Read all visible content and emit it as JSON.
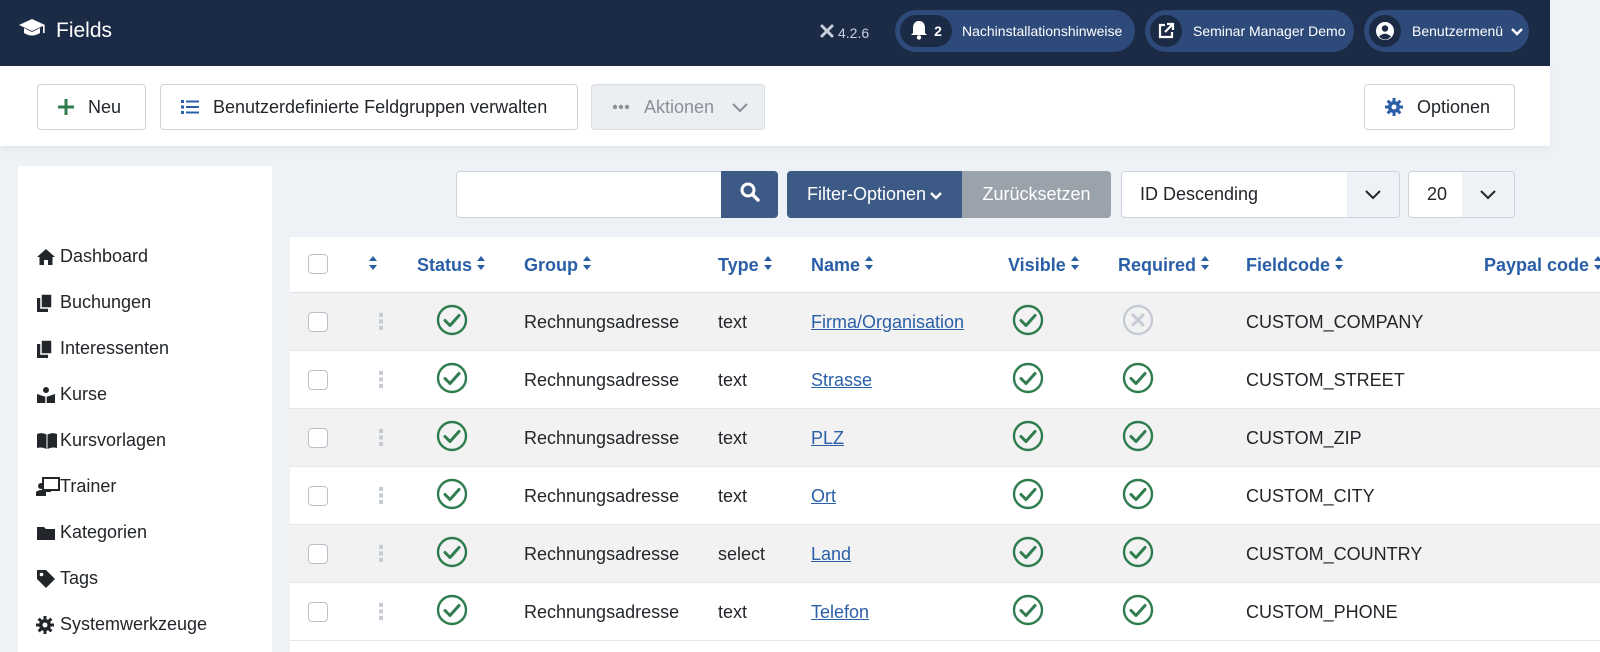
{
  "header": {
    "title": "Fields",
    "version": "4.2.6",
    "notifications_count": "2",
    "post_install_label": "Nachinstallationshinweise",
    "site_label": "Seminar Manager Demo",
    "user_menu_label": "Benutzermenü"
  },
  "toolbar": {
    "new_label": "Neu",
    "groups_label": "Benutzerdefinierte Feldgruppen verwalten",
    "actions_label": "Aktionen",
    "options_label": "Optionen"
  },
  "sidebar": {
    "items": [
      {
        "label": "Dashboard",
        "icon": "home-icon"
      },
      {
        "label": "Buchungen",
        "icon": "copy-icon"
      },
      {
        "label": "Interessenten",
        "icon": "copy-icon"
      },
      {
        "label": "Kurse",
        "icon": "course-icon"
      },
      {
        "label": "Kursvorlagen",
        "icon": "book-icon"
      },
      {
        "label": "Trainer",
        "icon": "trainer-icon"
      },
      {
        "label": "Kategorien",
        "icon": "folder-icon"
      },
      {
        "label": "Tags",
        "icon": "tag-icon"
      },
      {
        "label": "Systemwerkzeuge",
        "icon": "gear-icon"
      }
    ]
  },
  "filters": {
    "search_value": "",
    "filter_options_label": "Filter-Optionen",
    "reset_label": "Zurücksetzen",
    "ordering_value": "ID Descending",
    "limit_value": "20"
  },
  "table": {
    "columns": {
      "status": "Status",
      "group": "Group",
      "type": "Type",
      "name": "Name",
      "visible": "Visible",
      "required": "Required",
      "fieldcode": "Fieldcode",
      "paypal": "Paypal code"
    },
    "rows": [
      {
        "status": true,
        "group": "Rechnungsadresse",
        "type": "text",
        "name": "Firma/Organisation",
        "visible": true,
        "required": false,
        "fieldcode": "CUSTOM_COMPANY"
      },
      {
        "status": true,
        "group": "Rechnungsadresse",
        "type": "text",
        "name": "Strasse",
        "visible": true,
        "required": true,
        "fieldcode": "CUSTOM_STREET"
      },
      {
        "status": true,
        "group": "Rechnungsadresse",
        "type": "text",
        "name": "PLZ",
        "visible": true,
        "required": true,
        "fieldcode": "CUSTOM_ZIP"
      },
      {
        "status": true,
        "group": "Rechnungsadresse",
        "type": "text",
        "name": "Ort",
        "visible": true,
        "required": true,
        "fieldcode": "CUSTOM_CITY"
      },
      {
        "status": true,
        "group": "Rechnungsadresse",
        "type": "select",
        "name": "Land",
        "visible": true,
        "required": true,
        "fieldcode": "CUSTOM_COUNTRY"
      },
      {
        "status": true,
        "group": "Rechnungsadresse",
        "type": "text",
        "name": "Telefon",
        "visible": true,
        "required": true,
        "fieldcode": "CUSTOM_PHONE"
      }
    ]
  },
  "colors": {
    "header_bg": "#1c2b45",
    "accent": "#2a5fa8",
    "success": "#2f7d4f",
    "inactive": "#c5cbd2"
  }
}
